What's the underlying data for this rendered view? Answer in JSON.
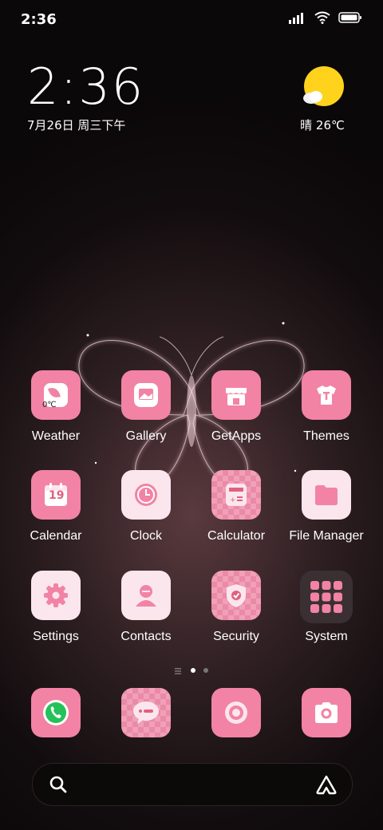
{
  "status_bar": {
    "time": "2:36",
    "icons": [
      "signal-icon",
      "wifi-icon",
      "battery-icon"
    ]
  },
  "clock_widget": {
    "time": "2:36",
    "date": "7月26日 周三下午"
  },
  "weather_widget": {
    "icon": "sunny-cloud-icon",
    "text": "晴 26℃"
  },
  "apps": [
    {
      "label": "Weather",
      "icon": "weather-icon",
      "badge": "0℃"
    },
    {
      "label": "Gallery",
      "icon": "gallery-icon"
    },
    {
      "label": "GetApps",
      "icon": "store-icon"
    },
    {
      "label": "Themes",
      "icon": "themes-icon"
    },
    {
      "label": "Calendar",
      "icon": "calendar-icon",
      "badge": "19"
    },
    {
      "label": "Clock",
      "icon": "clock-icon"
    },
    {
      "label": "Calculator",
      "icon": "calculator-icon"
    },
    {
      "label": "File Manager",
      "icon": "folder-icon"
    },
    {
      "label": "Settings",
      "icon": "gear-icon"
    },
    {
      "label": "Contacts",
      "icon": "contacts-icon"
    },
    {
      "label": "Security",
      "icon": "shield-icon"
    },
    {
      "label": "System",
      "icon": "system-folder-icon"
    }
  ],
  "dock": [
    "phone-icon",
    "messages-icon",
    "browser-icon",
    "camera-icon"
  ],
  "colors": {
    "accent_pink": "#f283a5",
    "light_pink": "#fbe6ee",
    "background": "#120c0e"
  }
}
